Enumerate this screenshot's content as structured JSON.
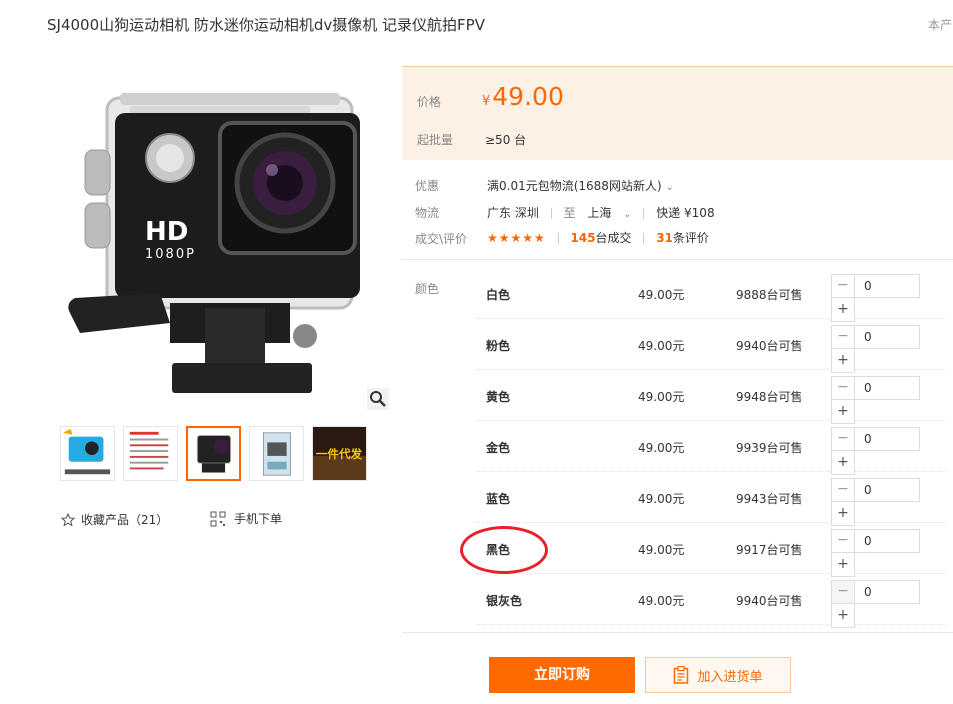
{
  "product": {
    "title": "SJ4000山狗运动相机 防水迷你运动相机dv摄像机 记录仪航拍FPV",
    "corner_text": "本产"
  },
  "gallery": {
    "camera_hd_text": "HD",
    "camera_res_text": "1080P",
    "thumb5_text": "一件代发",
    "favorite_label": "收藏产品（21）",
    "mobile_label": "手机下单"
  },
  "price": {
    "label": "价格",
    "currency": "¥",
    "value": "49.00",
    "moq_label": "起批量",
    "moq_value": "≥50 台"
  },
  "info": {
    "promo_label": "优惠",
    "promo_value": "满0.01元包物流(1688网站新人)",
    "logistics_label": "物流",
    "origin": "广东 深圳",
    "to": "至",
    "destination": "上海",
    "shipping": "快递 ¥108",
    "deals_label": "成交\\评价",
    "stars": "★★★★★",
    "sold_count": "145",
    "sold_suffix": "台成交",
    "review_count": "31",
    "review_suffix": "条评价"
  },
  "sku": {
    "color_label": "颜色",
    "rows": [
      {
        "name": "白色",
        "price": "49.00元",
        "stock": "9888台可售",
        "qty": "0"
      },
      {
        "name": "粉色",
        "price": "49.00元",
        "stock": "9940台可售",
        "qty": "0"
      },
      {
        "name": "黄色",
        "price": "49.00元",
        "stock": "9948台可售",
        "qty": "0"
      },
      {
        "name": "金色",
        "price": "49.00元",
        "stock": "9939台可售",
        "qty": "0"
      },
      {
        "name": "蓝色",
        "price": "49.00元",
        "stock": "9943台可售",
        "qty": "0"
      },
      {
        "name": "黑色",
        "price": "49.00元",
        "stock": "9917台可售",
        "qty": "0"
      },
      {
        "name": "银灰色",
        "price": "49.00元",
        "stock": "9940台可售",
        "qty": "0"
      }
    ],
    "minus": "−",
    "plus": "+"
  },
  "actions": {
    "buy_now": "立即订购",
    "add_to_list": "加入进货单"
  },
  "colors": {
    "accent": "#ff6a00",
    "price_bg": "#fdf1e6",
    "highlight": "#e62129"
  }
}
